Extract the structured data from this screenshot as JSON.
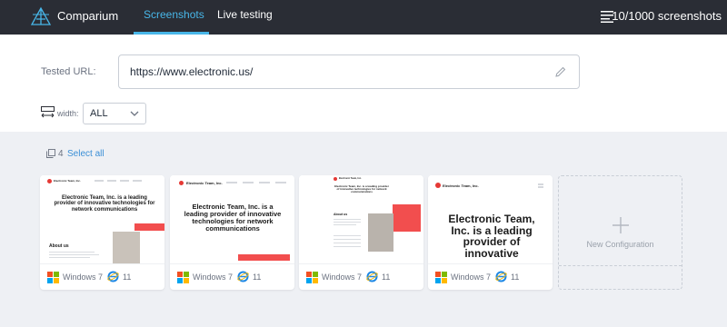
{
  "app": {
    "name": "Comparium"
  },
  "nav": {
    "tabs": [
      {
        "label": "Screenshots",
        "active": true
      },
      {
        "label": "Live testing",
        "active": false
      }
    ],
    "counter": "10/1000 screenshots"
  },
  "url_field": {
    "label": "Tested URL:",
    "value": "https://www.electronic.us/"
  },
  "width_filter": {
    "label": "width:",
    "value": "ALL"
  },
  "selection": {
    "count": "4",
    "select_all_label": "Select all"
  },
  "cards": [
    {
      "os": "Windows 7",
      "browser_version": "11",
      "brand": "Electronic Team, Inc.",
      "heading": "Electronic Team, Inc. is a leading provider of innovative technologies for network communications",
      "section": "About us"
    },
    {
      "os": "Windows 7",
      "browser_version": "11",
      "brand": "Electronic Team, Inc.",
      "heading": "Electronic Team, Inc. is a leading provider of innovative technologies for network communications"
    },
    {
      "os": "Windows 7",
      "browser_version": "11",
      "brand": "Electronic Team, Inc.",
      "heading": "Electronic Team, Inc. is a leading provider of innovative technologies for network communications",
      "section": "About us"
    },
    {
      "os": "Windows 7",
      "browser_version": "11",
      "brand": "Electronic Team, Inc.",
      "heading": "Electronic Team, Inc. is a leading provider of innovative"
    }
  ],
  "new_config": {
    "label": "New Configuration"
  },
  "colors": {
    "accent": "#48b6e8",
    "topbar": "#2a2d35",
    "link": "#3b8fd6",
    "brand_red": "#f24e4e"
  },
  "icons": [
    "comparium-logo-icon",
    "menu-list-icon",
    "pencil-icon",
    "width-icon",
    "chevron-down-icon",
    "copy-icon",
    "windows-icon",
    "ie-icon",
    "plus-icon"
  ]
}
